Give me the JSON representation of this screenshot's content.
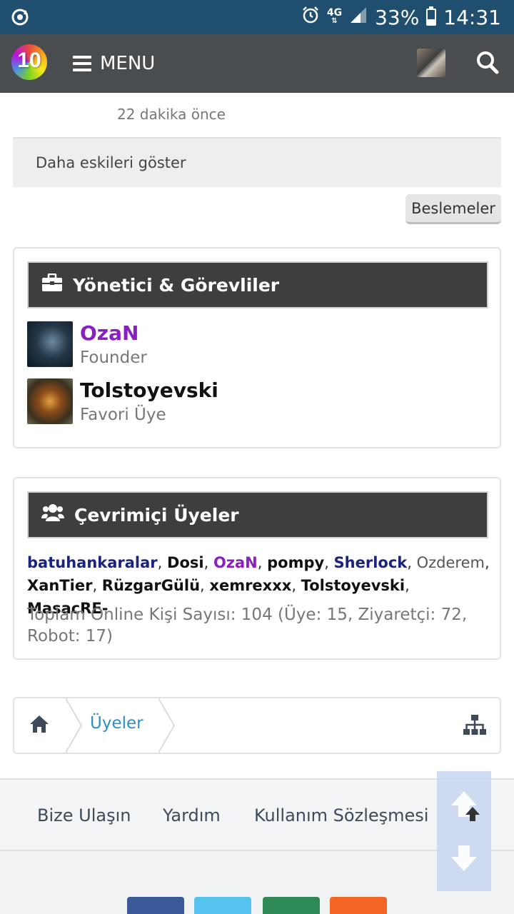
{
  "status_bar": {
    "network": "4G",
    "battery": "33%",
    "time": "14:31",
    "battery_level": 0.33
  },
  "header": {
    "logo_text": "10",
    "menu_label": "MENU"
  },
  "feed": {
    "time_ago": "22 dakika önce",
    "show_older": "Daha eskileri göster",
    "feeds_button": "Beslemeler"
  },
  "staff": {
    "title": "Yönetici & Görevliler",
    "members": [
      {
        "name": "OzaN",
        "role": "Founder",
        "color": "#8a1fbf"
      },
      {
        "name": "Tolstoyevski",
        "role": "Favori Üye",
        "color": "#111111"
      }
    ]
  },
  "online": {
    "title": "Çevrimiçi Üyeler",
    "members": [
      {
        "name": "batuhankaralar",
        "color": "#1a237e",
        "bold": true
      },
      {
        "name": "Dosi",
        "color": "#111111",
        "bold": true
      },
      {
        "name": "OzaN",
        "color": "#8a1fbf",
        "bold": true
      },
      {
        "name": "pompy",
        "color": "#111111",
        "bold": true
      },
      {
        "name": "Sherlock",
        "color": "#1a237e",
        "bold": true
      },
      {
        "name": "Ozderem",
        "color": "#555555",
        "bold": false
      },
      {
        "name": "XanTier",
        "color": "#111111",
        "bold": true
      },
      {
        "name": "RüzgarGülü",
        "color": "#111111",
        "bold": true
      },
      {
        "name": "xemrexxx",
        "color": "#111111",
        "bold": true
      },
      {
        "name": "Tolstoyevski",
        "color": "#111111",
        "bold": true
      },
      {
        "name": "MasacRE-",
        "color": "#111111",
        "bold": true
      }
    ],
    "stats": "Toplam Online Kişi Sayısı: 104 (Üye: 15, Ziyaretçi: 72, Robot: 17)"
  },
  "breadcrumb": {
    "items": [
      "Üyeler"
    ]
  },
  "footer": {
    "links": [
      "Bize Ulaşın",
      "Yardım",
      "Kullanım Sözleşmesi"
    ]
  },
  "social": {
    "colors": [
      "#3b5998",
      "#55c4ee",
      "#2e8b57",
      "#f26522"
    ]
  },
  "colors": {
    "status_bar": "#1f4e6e",
    "app_bar": "#4a4d50",
    "panel_header": "#3d3e3f",
    "link": "#2f8fbf"
  }
}
